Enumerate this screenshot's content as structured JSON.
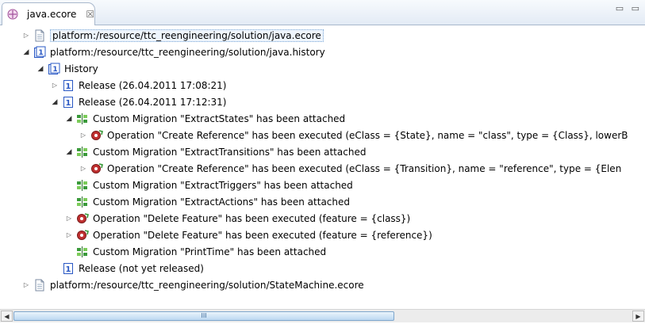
{
  "tab": {
    "title": "java.ecore",
    "close_glyph": "☒",
    "view_controls": "▭ ▭"
  },
  "tree": {
    "nodes": [
      {
        "label": "platform:/resource/ttc_reengineering/solution/java.ecore",
        "level": 0,
        "state": "collapsed",
        "icon": "resource-file-icon"
      },
      {
        "label": "platform:/resource/ttc_reengineering/solution/java.history",
        "level": 0,
        "state": "expanded",
        "icon": "history-icon"
      },
      {
        "label": "History",
        "level": 1,
        "state": "expanded",
        "icon": "history-icon"
      },
      {
        "label": "Release (26.04.2011 17:08:21)",
        "level": 2,
        "state": "collapsed",
        "icon": "release-icon"
      },
      {
        "label": "Release (26.04.2011 17:12:31)",
        "level": 2,
        "state": "expanded",
        "icon": "release-icon"
      },
      {
        "label": "Custom Migration \"ExtractStates\" has been attached",
        "level": 3,
        "state": "expanded",
        "icon": "custom-migration-icon"
      },
      {
        "label": "Operation \"Create Reference\" has been executed (eClass = {State}, name = \"class\", type = {Class}, lowerB",
        "level": 4,
        "state": "collapsed",
        "icon": "operation-icon"
      },
      {
        "label": "Custom Migration \"ExtractTransitions\" has been attached",
        "level": 3,
        "state": "expanded",
        "icon": "custom-migration-icon"
      },
      {
        "label": "Operation \"Create Reference\" has been executed (eClass = {Transition}, name = \"reference\", type = {Elen",
        "level": 4,
        "state": "collapsed",
        "icon": "operation-icon"
      },
      {
        "label": "Custom Migration \"ExtractTriggers\" has been attached",
        "level": 3,
        "state": "none",
        "icon": "custom-migration-icon"
      },
      {
        "label": "Custom Migration \"ExtractActions\" has been attached",
        "level": 3,
        "state": "none",
        "icon": "custom-migration-icon"
      },
      {
        "label": "Operation \"Delete Feature\" has been executed (feature = {class})",
        "level": 3,
        "state": "collapsed",
        "icon": "operation-icon"
      },
      {
        "label": "Operation \"Delete Feature\" has been executed (feature = {reference})",
        "level": 3,
        "state": "collapsed",
        "icon": "operation-icon"
      },
      {
        "label": "Custom Migration \"PrintTime\" has been attached",
        "level": 3,
        "state": "none",
        "icon": "custom-migration-icon"
      },
      {
        "label": "Release (not yet released)",
        "level": 2,
        "state": "none",
        "icon": "release-icon"
      },
      {
        "label": "platform:/resource/ttc_reengineering/solution/StateMachine.ecore",
        "level": 0,
        "state": "collapsed",
        "icon": "resource-file-icon"
      }
    ]
  },
  "scrollbar": {
    "left_arrow": "◀",
    "right_arrow": "▶",
    "thumb_grip": "III"
  },
  "colors": {
    "selection_border": "#7aa7d6",
    "history_blue": "#2a58c4",
    "migration_green": "#3a9a3a",
    "operation_red": "#c03030"
  }
}
